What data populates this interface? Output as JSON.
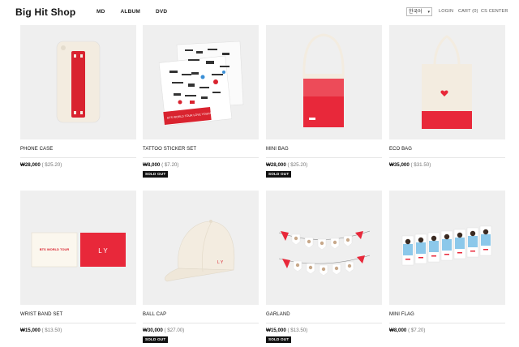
{
  "header": {
    "logo": "Big Hit Shop",
    "nav": [
      "MD",
      "ALBUM",
      "DVD"
    ],
    "language": "한국어",
    "login": "LOGIN",
    "cart": "CART (0)",
    "cs_center": "CS CENTER"
  },
  "products": [
    {
      "name": "PHONE CASE",
      "price": "₩28,000",
      "usd": "( $25.20)",
      "sold_out": ""
    },
    {
      "name": "TATTOO STICKER SET",
      "price": "₩8,000",
      "usd": "( $7.20)",
      "sold_out": "SOLD OUT"
    },
    {
      "name": "MINI BAG",
      "price": "₩28,000",
      "usd": "( $25.20)",
      "sold_out": "SOLD OUT"
    },
    {
      "name": "ECO BAG",
      "price": "₩35,000",
      "usd": "( $31.50)",
      "sold_out": ""
    },
    {
      "name": "WRIST BAND SET",
      "price": "₩15,000",
      "usd": "( $13.50)",
      "sold_out": ""
    },
    {
      "name": "BALL CAP",
      "price": "₩30,000",
      "usd": "( $27.00)",
      "sold_out": "SOLD OUT"
    },
    {
      "name": "GARLAND",
      "price": "₩15,000",
      "usd": "( $13.50)",
      "sold_out": "SOLD OUT"
    },
    {
      "name": "MINI FLAG",
      "price": "₩8,000",
      "usd": "( $7.20)",
      "sold_out": ""
    }
  ],
  "product_art": {
    "wristband_card_text": "BTS WORLD TOUR",
    "wristband_text": "L Y",
    "cap_text": "L Y",
    "sticker_text": "BTS WORLD TOUR LOVE YOURSELF"
  },
  "colors": {
    "accent_red": "#e8283a",
    "thumb_bg": "#efefef",
    "cream": "#f3ece0"
  },
  "icons": {
    "lang_caret": "▾"
  }
}
